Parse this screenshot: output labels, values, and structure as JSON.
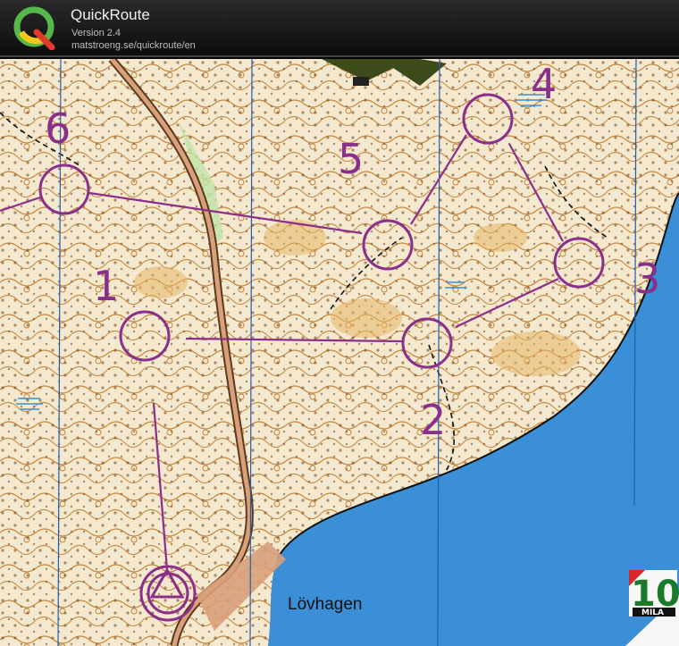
{
  "app": {
    "title": "QuickRoute",
    "version": "Version 2.4",
    "url": "matstroeng.se/quickroute/en",
    "logo_letter": "Q"
  },
  "map": {
    "course_color": "#8a2f8a",
    "water_color": "#3a8fd6",
    "controls": [
      {
        "number": "1"
      },
      {
        "number": "2"
      },
      {
        "number": "3"
      },
      {
        "number": "4"
      },
      {
        "number": "5"
      },
      {
        "number": "6"
      }
    ],
    "place_name": "Lövhagen",
    "badge": {
      "number": "10",
      "label": "MILA"
    }
  }
}
